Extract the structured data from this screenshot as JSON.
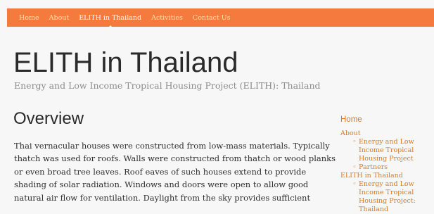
{
  "nav": {
    "items": [
      {
        "label": "Home"
      },
      {
        "label": "About"
      },
      {
        "label": "ELITH in Thailand"
      },
      {
        "label": "Activities"
      },
      {
        "label": "Contact Us"
      }
    ]
  },
  "header": {
    "title": "ELITH in Thailand",
    "subtitle": "Energy and Low Income Tropical Housing Project (ELITH): Thailand"
  },
  "main": {
    "heading": "Overview",
    "lines": [
      "Thai vernacular houses were constructed from low-mass materials. Typically",
      "thatch was used for roofs. Walls were constructed from thatch or wood planks",
      "or even broad tree leaves. Roof eaves of such houses extend to provide",
      "shading of solar radiation. Windows and doors were open to allow good",
      "natural air flow for ventilation. Daylight from the sky provides sufficient"
    ]
  },
  "sidebar": {
    "home": "Home",
    "about": "About",
    "about_children": [
      "Energy and Low Income Tropical Housing Project",
      "Partners"
    ],
    "elith": "ELITH in Thailand",
    "elith_children": [
      "Energy and Low Income Tropical Housing Project: Thailand"
    ]
  },
  "colors": {
    "nav_bg": "#f47a3e",
    "link": "#e07a1c",
    "nav_text": "#ffe2a8"
  }
}
